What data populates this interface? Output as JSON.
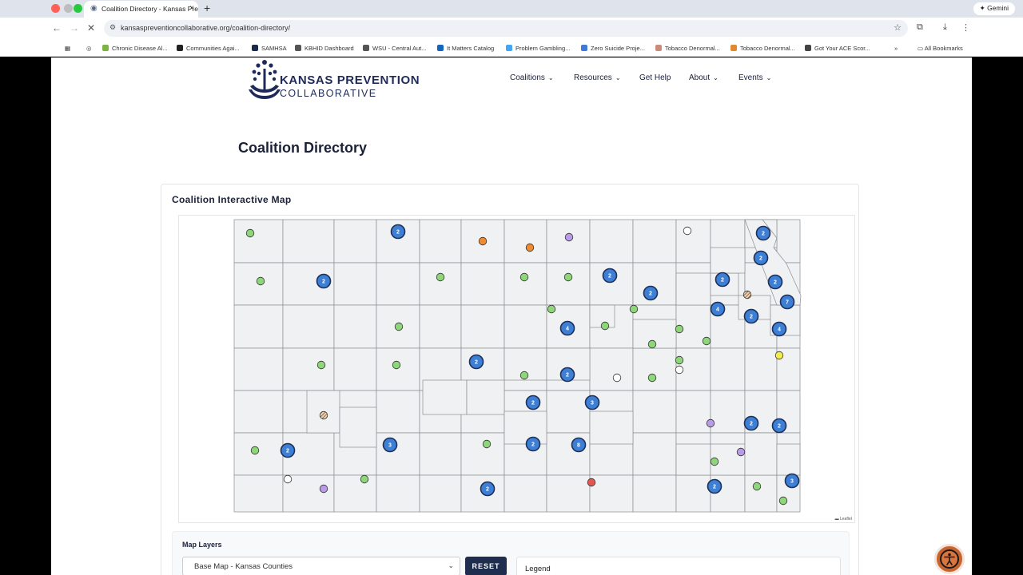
{
  "browser": {
    "tab_title": "Coalition Directory - Kansas Pre",
    "tab_close": "×",
    "new_tab": "+",
    "gemini_label": "Gemini",
    "url": "kansaspreventioncollaborative.org/coalition-directory/",
    "bookmarks": [
      {
        "label": "Chronic Disease Al...",
        "color": "#7cb342"
      },
      {
        "label": "Communities Agai...",
        "color": "#222222"
      },
      {
        "label": "SAMHSA",
        "color": "#1b2a4a"
      },
      {
        "label": "KBHID Dashboard",
        "color": "#555555"
      },
      {
        "label": "WSU - Central Aut...",
        "color": "#555555"
      },
      {
        "label": "It Matters Catalog",
        "color": "#1565c0"
      },
      {
        "label": "Problem Gambling...",
        "color": "#42a5f5"
      },
      {
        "label": "Zero Suicide Proje...",
        "color": "#3f7bd6"
      },
      {
        "label": "Tobacco Denormal...",
        "color": "#c98b7a"
      },
      {
        "label": "Tobacco Denormal...",
        "color": "#e08a2e"
      },
      {
        "label": "Got Your ACE Scor...",
        "color": "#444444"
      }
    ],
    "all_bookmarks": "All Bookmarks"
  },
  "site": {
    "logo_title": "KANSAS PREVENTION",
    "logo_subtitle": "COLLABORATIVE",
    "nav": [
      {
        "label": "Coalitions",
        "dropdown": true
      },
      {
        "label": "Resources",
        "dropdown": true
      },
      {
        "label": "Get Help",
        "dropdown": false
      },
      {
        "label": "About",
        "dropdown": true
      },
      {
        "label": "Events",
        "dropdown": true
      }
    ],
    "page_title": "Coalition Directory",
    "card_title": "Coalition Interactive Map",
    "attribution": "Leaflet",
    "map_layers_title": "Map Layers",
    "layer_select_value": "Base Map - Kansas Counties",
    "reset_label": "RESET",
    "legend_title": "Legend"
  },
  "colors": {
    "cluster": "#3d7fd4",
    "green": "#8fd67a",
    "orange": "#ef8a2f",
    "purple": "#b99be8",
    "red": "#e0584f",
    "yellow": "#f2ec4b",
    "empty": "#ffffff",
    "county_fill": "#f0f1f2",
    "county_stroke": "#8a8d93"
  },
  "map_markers": {
    "clusters": [
      {
        "county": "Jewell",
        "count": "2"
      },
      {
        "county": "Doniphan",
        "count": "2"
      },
      {
        "county": "Sheridan",
        "count": "2"
      },
      {
        "county": "Atchison",
        "count": "2"
      },
      {
        "county": "Clay",
        "count": "2"
      },
      {
        "county": "Jackson",
        "count": "2"
      },
      {
        "county": "Pottawatomie",
        "count": "2"
      },
      {
        "county": "Leavenworth",
        "count": "2"
      },
      {
        "county": "Wyandotte",
        "count": "7"
      },
      {
        "county": "Shawnee",
        "count": "4"
      },
      {
        "county": "Douglas",
        "count": "2"
      },
      {
        "county": "Johnson",
        "count": "4"
      },
      {
        "county": "Saline",
        "count": "4"
      },
      {
        "county": "Pawnee",
        "count": "2"
      },
      {
        "county": "McPherson",
        "count": "2"
      },
      {
        "county": "Reno",
        "count": "2"
      },
      {
        "county": "Harvey",
        "count": "3"
      },
      {
        "county": "Allen",
        "count": "2"
      },
      {
        "county": "Bourbon",
        "count": "2"
      },
      {
        "county": "Seward",
        "count": "2"
      },
      {
        "county": "Ford",
        "count": "3"
      },
      {
        "county": "Kingman",
        "count": "2"
      },
      {
        "county": "Sedgwick",
        "count": "8"
      },
      {
        "county": "Barber",
        "count": "2"
      },
      {
        "county": "Montgomery",
        "count": "2"
      },
      {
        "county": "Cherokee",
        "count": "3"
      }
    ],
    "points": [
      {
        "county": "Cheyenne",
        "type": "green"
      },
      {
        "county": "Smith",
        "type": "orange"
      },
      {
        "county": "Republic",
        "type": "orange"
      },
      {
        "county": "Washington",
        "type": "purple"
      },
      {
        "county": "Brown",
        "type": "empty"
      },
      {
        "county": "Sherman",
        "type": "green"
      },
      {
        "county": "Rooks",
        "type": "green"
      },
      {
        "county": "Mitchell",
        "type": "green"
      },
      {
        "county": "Cloud",
        "type": "green"
      },
      {
        "county": "Jefferson",
        "type": "hatched"
      },
      {
        "county": "Ottawa",
        "type": "green"
      },
      {
        "county": "Riley",
        "type": "green"
      },
      {
        "county": "Geary",
        "type": "green"
      },
      {
        "county": "Gove",
        "type": "green"
      },
      {
        "county": "Wabaunsee",
        "type": "green"
      },
      {
        "county": "Osage",
        "type": "green"
      },
      {
        "county": "Morris",
        "type": "green"
      },
      {
        "county": "Scott",
        "type": "green"
      },
      {
        "county": "Rush",
        "type": "green"
      },
      {
        "county": "Rice",
        "type": "green"
      },
      {
        "county": "Marion",
        "type": "empty"
      },
      {
        "county": "Chase",
        "type": "green"
      },
      {
        "county": "Franklin",
        "type": "empty"
      },
      {
        "county": "Miami",
        "type": "yellow"
      },
      {
        "county": "Lyon",
        "type": "green"
      },
      {
        "county": "Finney",
        "type": "hatched"
      },
      {
        "county": "Woodson",
        "type": "purple"
      },
      {
        "county": "Stanton",
        "type": "green"
      },
      {
        "county": "Pratt",
        "type": "green"
      },
      {
        "county": "Wilson",
        "type": "green"
      },
      {
        "county": "Neosho",
        "type": "purple"
      },
      {
        "county": "Stevens",
        "type": "empty"
      },
      {
        "county": "Meade",
        "type": "purple"
      },
      {
        "county": "Clark",
        "type": "green"
      },
      {
        "county": "Sumner",
        "type": "red"
      },
      {
        "county": "Labette",
        "type": "green"
      },
      {
        "county": "Cherokee",
        "type": "green"
      }
    ]
  }
}
